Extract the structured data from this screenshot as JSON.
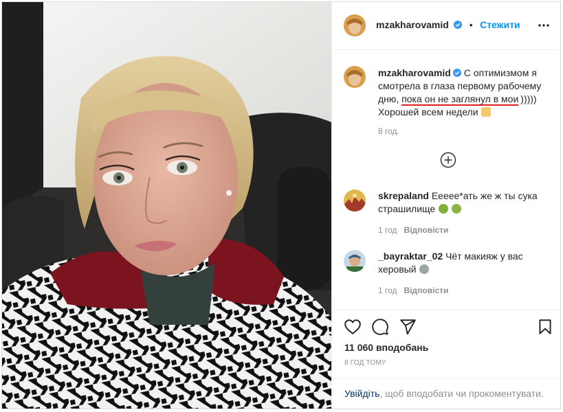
{
  "header": {
    "username": "mzakharovamid",
    "dot": "•",
    "follow_label": "Стежити"
  },
  "caption": {
    "username": "mzakharovamid",
    "line1": "С оптимизмом я",
    "line2": "смотрела в глаза первому рабочему",
    "line3a": "дню, ",
    "line3b": "пока он не заглянул в мои",
    "line3c": ")))))",
    "line4": "Хорошей всем недели",
    "time": "8 год."
  },
  "comments": [
    {
      "username": "skrepaland",
      "text_line1": "Ееееe*ать же ж ты сука",
      "text_line2": "страшилище",
      "time": "1 год",
      "reply_label": "Відповісти"
    },
    {
      "username": "_bayraktar_02",
      "text_line1": "Чёт макияж у вас",
      "text_line2": "херовый",
      "time": "1 год",
      "reply_label": "Відповісти"
    }
  ],
  "likes": "11 060 вподобань",
  "posted": "8 ГОД ТОМУ",
  "footer": {
    "login_link": "Увійдіть",
    "rest": ", щоб вподобати чи прокоментувати."
  },
  "colors": {
    "accent": "#0095f6",
    "underline": "#e02020",
    "text": "#262626",
    "muted": "#8e8e8e"
  }
}
